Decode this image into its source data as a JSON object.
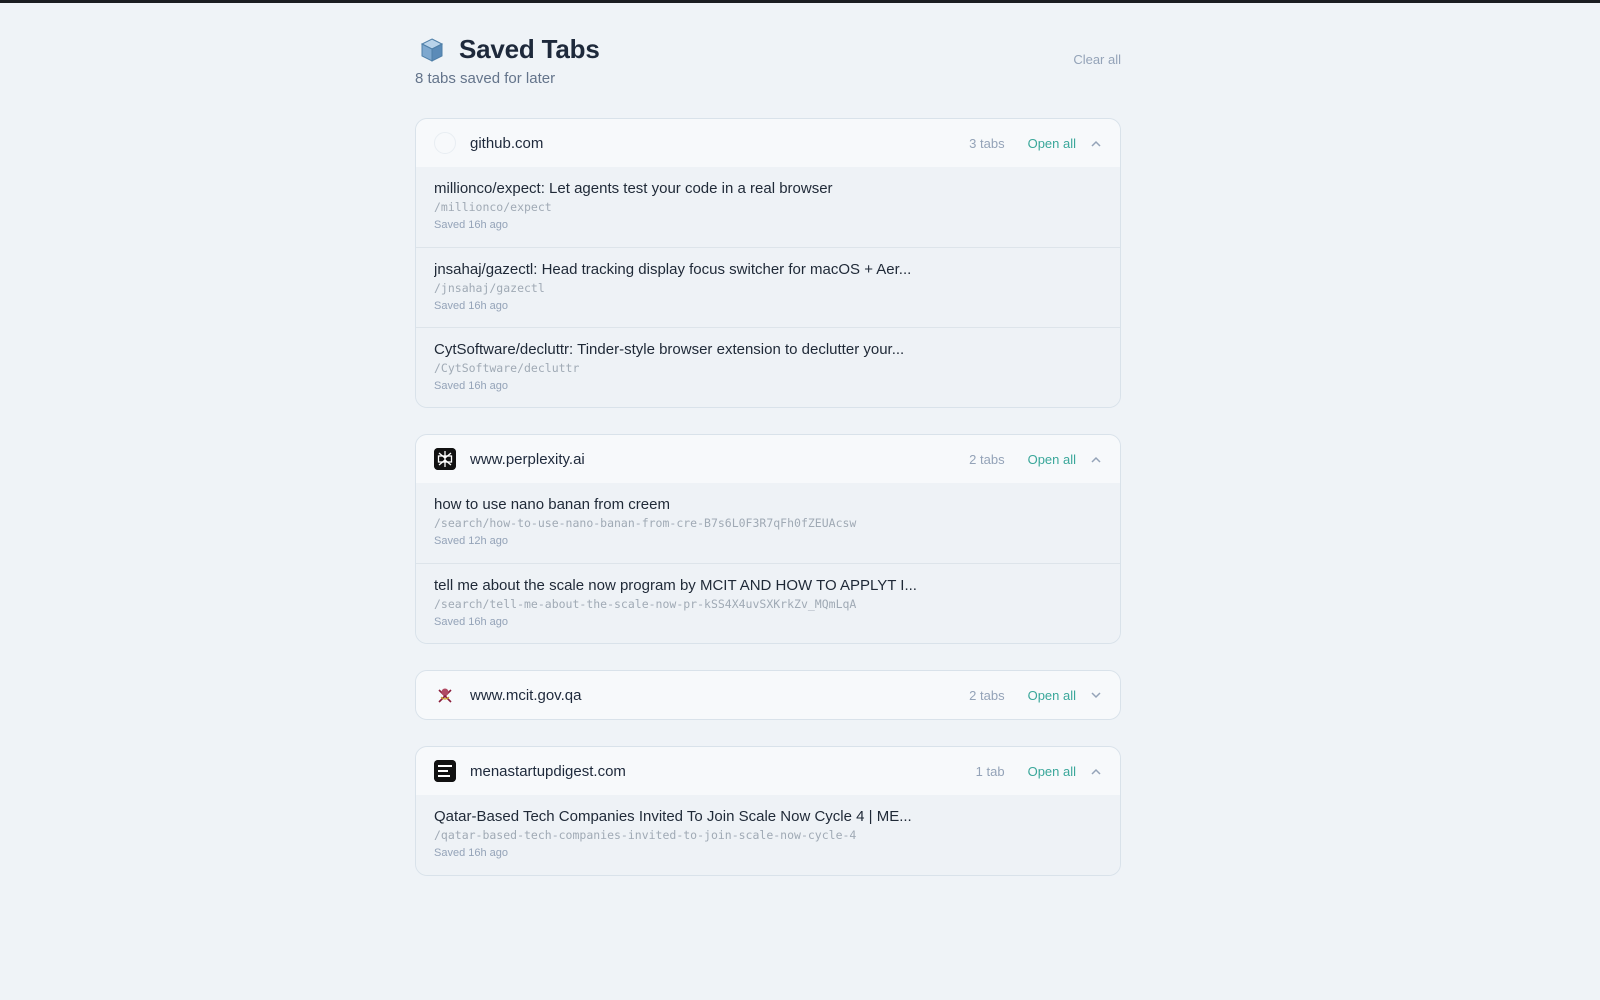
{
  "header": {
    "title": "Saved Tabs",
    "subtitle": "8 tabs saved for later",
    "clear_all": "Clear all",
    "icon": "box-icon"
  },
  "colors": {
    "accent": "#3aa79a",
    "background": "#eff3f7",
    "muted": "#94a3b8"
  },
  "groups": [
    {
      "domain": "github.com",
      "count": "3 tabs",
      "open_all": "Open all",
      "expanded": true,
      "favicon": "github-icon",
      "tabs": [
        {
          "title": "millionco/expect: Let agents test your code in a real browser",
          "path": "/millionco/expect",
          "saved": "Saved 16h ago"
        },
        {
          "title": "jnsahaj/gazectl: Head tracking display focus switcher for macOS + Aer...",
          "path": "/jnsahaj/gazectl",
          "saved": "Saved 16h ago"
        },
        {
          "title": "CytSoftware/decluttr: Tinder-style browser extension to declutter your...",
          "path": "/CytSoftware/decluttr",
          "saved": "Saved 16h ago"
        }
      ]
    },
    {
      "domain": "www.perplexity.ai",
      "count": "2 tabs",
      "open_all": "Open all",
      "expanded": true,
      "favicon": "perplexity-icon",
      "tabs": [
        {
          "title": "how to use nano banan from creem",
          "path": "/search/how-to-use-nano-banan-from-cre-B7s6L0F3R7qFh0fZEUAcsw",
          "saved": "Saved 12h ago"
        },
        {
          "title": "tell me about the scale now program by MCIT AND HOW TO APPLYT I...",
          "path": "/search/tell-me-about-the-scale-now-pr-kSS4X4uvSXKrkZv_MQmLqA",
          "saved": "Saved 16h ago"
        }
      ]
    },
    {
      "domain": "www.mcit.gov.qa",
      "count": "2 tabs",
      "open_all": "Open all",
      "expanded": false,
      "favicon": "mcit-emblem-icon",
      "tabs": []
    },
    {
      "domain": "menastartupdigest.com",
      "count": "1 tab",
      "open_all": "Open all",
      "expanded": true,
      "favicon": "mena-startup-digest-icon",
      "tabs": [
        {
          "title": "Qatar-Based Tech Companies Invited To Join Scale Now Cycle 4 | ME...",
          "path": "/qatar-based-tech-companies-invited-to-join-scale-now-cycle-4",
          "saved": "Saved 16h ago"
        }
      ]
    }
  ]
}
